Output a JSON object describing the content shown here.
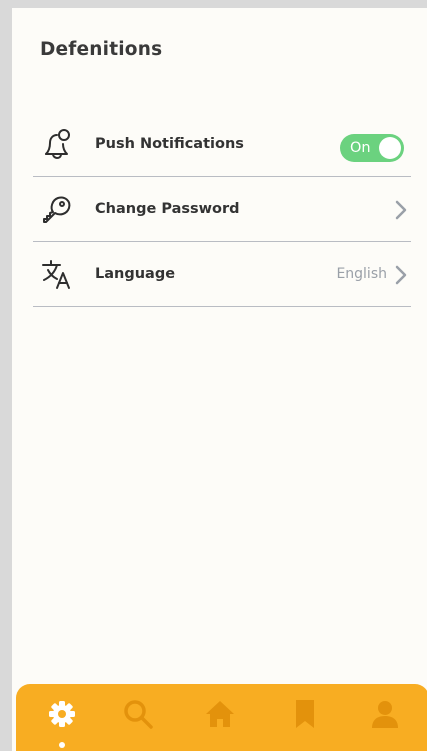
{
  "header": {
    "title": "Defenitions"
  },
  "settings": [
    {
      "label": "Push Notifications",
      "icon": "bell-icon",
      "control": "toggle",
      "toggle_label": "On",
      "toggle_on": true
    },
    {
      "label": "Change Password",
      "icon": "key-icon",
      "control": "chevron"
    },
    {
      "label": "Language",
      "icon": "translate-icon",
      "control": "chevron",
      "value": "English"
    }
  ],
  "bottom_nav": {
    "active": "settings",
    "items": [
      {
        "icon": "gear-icon",
        "name": "settings"
      },
      {
        "icon": "search-icon",
        "name": "search"
      },
      {
        "icon": "home-icon",
        "name": "home"
      },
      {
        "icon": "bookmark-icon",
        "name": "bookmarks"
      },
      {
        "icon": "user-icon",
        "name": "profile"
      }
    ]
  },
  "colors": {
    "background": "#fdfcf8",
    "accent": "#f8ad22",
    "toggle_on": "#6bd27f",
    "nav_icon_inactive": "#e3920c",
    "divider": "#b9bcc3"
  }
}
